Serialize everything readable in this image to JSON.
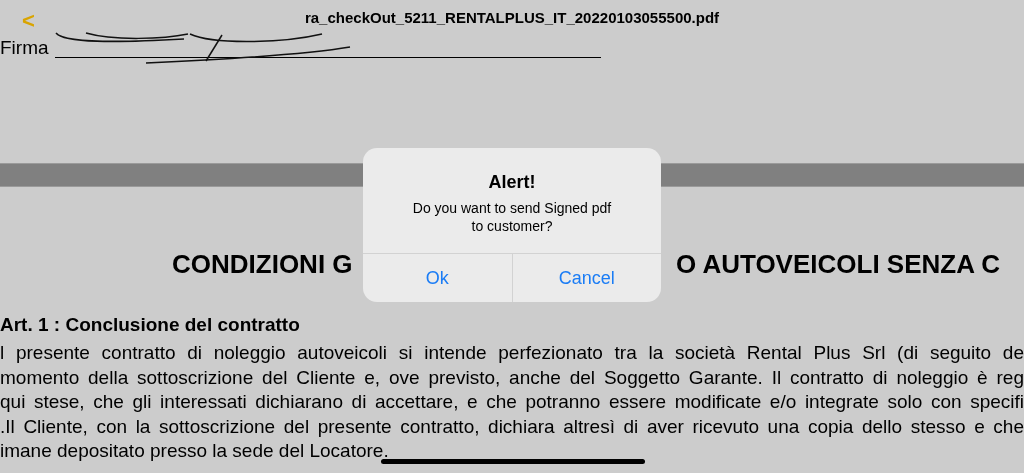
{
  "nav_bar": {
    "back": "<",
    "title": "ra_checkOut_5211_RENTALPLUS_IT_20220103055500.pdf"
  },
  "document": {
    "signature_label": "Firma",
    "heading_parts": [
      "CONDIZIONI G",
      "O AUTOVEICOLI SENZA C"
    ],
    "article_title": "Art. 1 : Conclusione del contratto",
    "lines": [
      "l presente contratto di noleggio autoveicoli si intende perfezionato tra la società Rental Plus Srl (di seguito de",
      "momento della sottoscrizione del Cliente e, ove previsto, anche del Soggetto Garante. Il contratto di noleggio è reg",
      "qui stese, che gli interessati dichiarano di accettare, e che potranno essere modificate e/o integrate solo con specifi",
      ".Il Cliente, con la sottoscrizione del presente contratto, dichiara altresì di aver ricevuto una copia dello stesso e che",
      "imane depositato presso la sede del Locatore."
    ]
  },
  "alert": {
    "title": "Alert!",
    "message": "Do you want to send Signed pdf to customer?",
    "buttons": [
      "Ok",
      "Cancel"
    ]
  }
}
